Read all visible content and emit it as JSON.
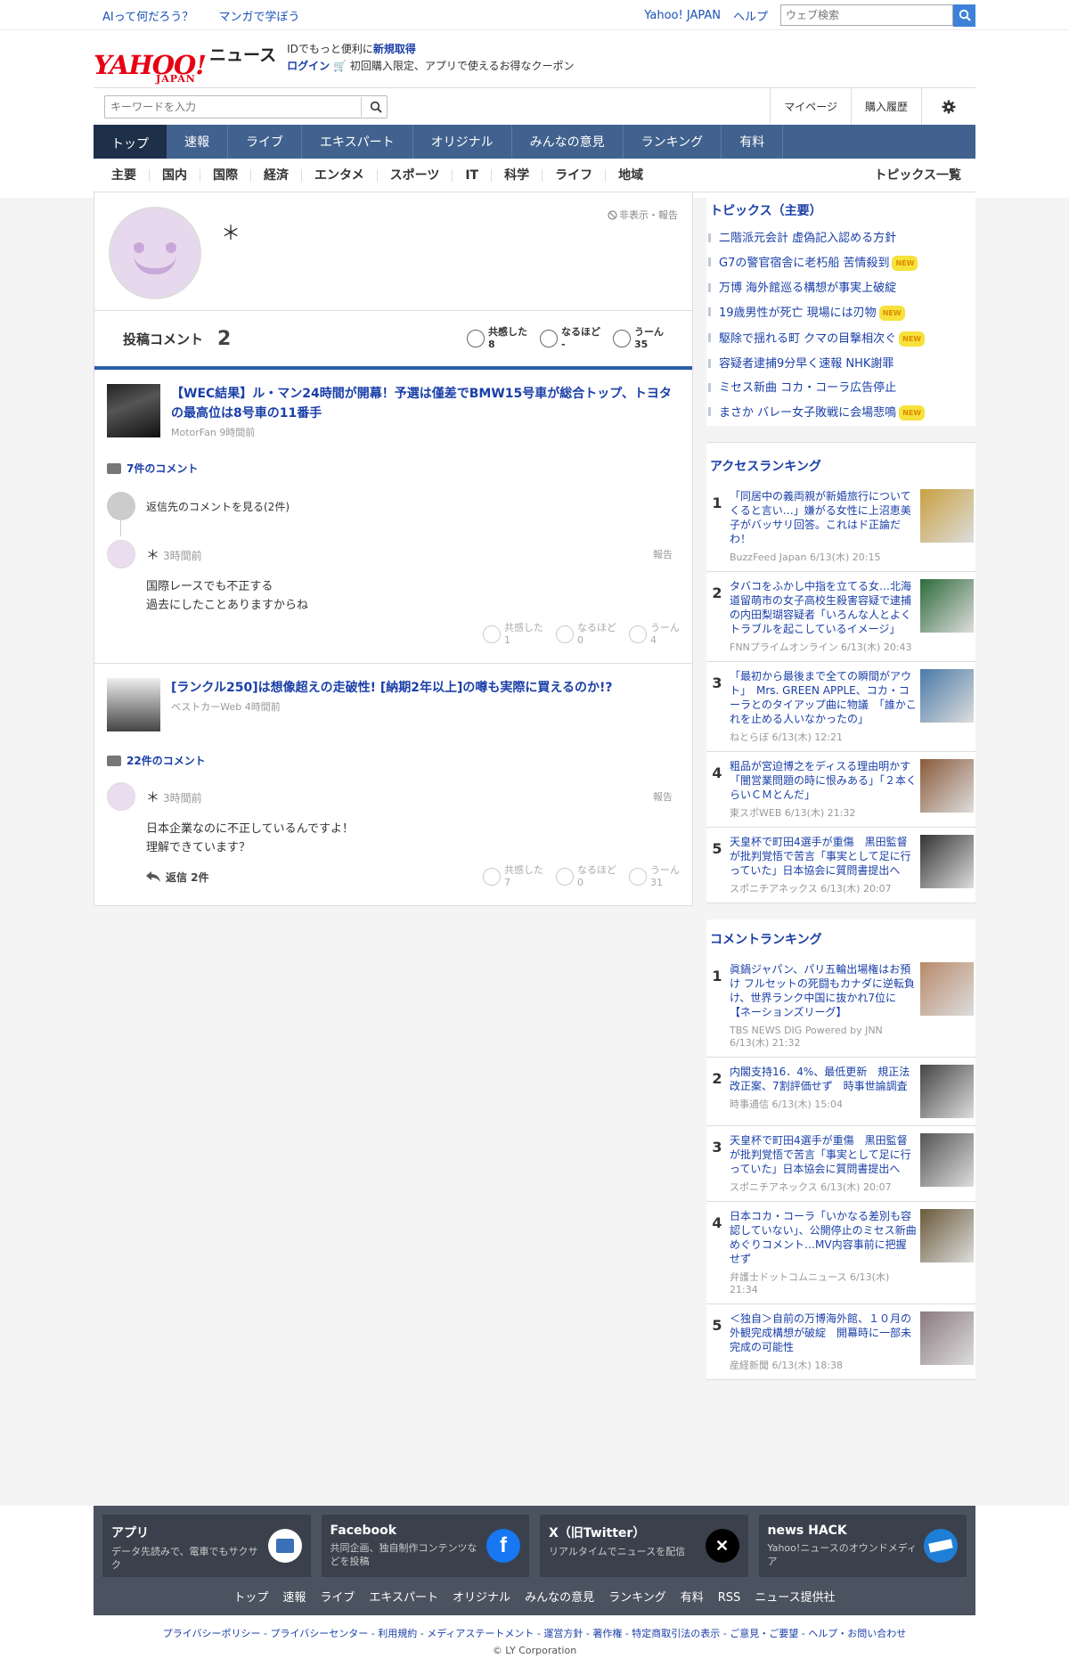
{
  "util": {
    "left_links": [
      "AIって何だろう？",
      "マンガで学ぼう"
    ],
    "right_links": [
      "Yahoo! JAPAN",
      "ヘルプ"
    ],
    "web_search_placeholder": "ウェブ検索"
  },
  "logo": {
    "brand": "YAHOO!",
    "sub": "JAPAN",
    "service": "ニュース"
  },
  "promo": {
    "line1_prefix": "IDでもっと便利に",
    "line1_link": "新規取得",
    "login": "ログイン",
    "line2": "初回購入限定、アプリで使えるお得なクーポン"
  },
  "search": {
    "placeholder": "キーワードを入力"
  },
  "mylinks": {
    "mypage": "マイページ",
    "history": "購入履歴"
  },
  "mainnav": [
    "トップ",
    "速報",
    "ライブ",
    "エキスパート",
    "オリジナル",
    "みんなの意見",
    "ランキング",
    "有料"
  ],
  "subnav": {
    "items": [
      "主要",
      "国内",
      "国際",
      "経済",
      "エンタメ",
      "スポーツ",
      "IT",
      "科学",
      "ライフ",
      "地域"
    ],
    "all": "トピックス一覧"
  },
  "profile": {
    "name": "＊",
    "hide_report": "非表示・報告"
  },
  "stats": {
    "label": "投稿コメント",
    "count": "2",
    "reactions": [
      {
        "label": "共感した",
        "value": "8"
      },
      {
        "label": "なるほど",
        "value": "-"
      },
      {
        "label": "うーん",
        "value": "35"
      }
    ]
  },
  "comments": [
    {
      "title": "【WEC結果】ル・マン24時間が開幕！予選は僅差でBMW15号車が総合トップ、トヨタの最高位は8号車の11番手",
      "source": "MotorFan 9時間前",
      "comment_count": "7件のコメント",
      "prev_link": "返信先のコメントを見る(2件)",
      "user": "＊",
      "time": "3時間前",
      "report": "報告",
      "body_1": "国際レースでも不正する",
      "body_2": "過去にしたことありますからね",
      "reactions": [
        {
          "label": "共感した",
          "value": "1"
        },
        {
          "label": "なるほど",
          "value": "0"
        },
        {
          "label": "うーん",
          "value": "4"
        }
      ]
    },
    {
      "title": "[ランクル250]は想像超えの走破性! [納期2年以上]の噂も実際に買えるのか!?",
      "source": "ベストカーWeb 4時間前",
      "comment_count": "22件のコメント",
      "user": "＊",
      "time": "3時間前",
      "report": "報告",
      "body_1": "日本企業なのに不正しているんですよ！",
      "body_2": "理解できています？",
      "replies": "返信 2件",
      "reactions": [
        {
          "label": "共感した",
          "value": "7"
        },
        {
          "label": "なるほど",
          "value": "0"
        },
        {
          "label": "うーん",
          "value": "31"
        }
      ]
    }
  ],
  "topics": {
    "title": "トピックス（主要）",
    "new_badge": "NEW",
    "items": [
      {
        "text": "二階派元会計 虚偽記入認める方針",
        "new": false
      },
      {
        "text": "G7の警官宿舎に老朽船 苦情殺到",
        "new": true
      },
      {
        "text": "万博 海外館巡る構想が事実上破綻",
        "new": false
      },
      {
        "text": "19歳男性が死亡 現場には刃物",
        "new": true
      },
      {
        "text": "駆除で揺れる町 クマの目撃相次ぐ",
        "new": true
      },
      {
        "text": "容疑者逮捕9分早く速報 NHK謝罪",
        "new": false
      },
      {
        "text": "ミセス新曲 コカ・コーラ広告停止",
        "new": false
      },
      {
        "text": "まさか バレー女子敗戦に会場悲鳴",
        "new": true
      }
    ]
  },
  "access_ranking": {
    "title": "アクセスランキング",
    "items": [
      {
        "rank": "1",
        "title": "「同居中の義両親が新婚旅行についてくると言い…」嫌がる女性に上沼恵美子がバッサリ回答。これはド正論だわ！",
        "source": "BuzzFeed Japan 6/13(木) 20:15"
      },
      {
        "rank": "2",
        "title": "タバコをふかし中指を立てる女…北海道留萌市の女子高校生殺害容疑で逮捕の内田梨瑚容疑者「いろんな人とよくトラブルを起こしているイメージ」",
        "source": "FNNプライムオンライン 6/13(木) 20:43"
      },
      {
        "rank": "3",
        "title": "「最初から最後まで全ての瞬間がアウト」　Mrs. GREEN APPLE、コカ・コーラとのタイアップ曲に物議　「誰かこれを止める人いなかったの」",
        "source": "ねとらぼ 6/13(木) 12:21"
      },
      {
        "rank": "4",
        "title": "粗品が宮迫博之をディスる理由明かす「闇営業問題の時に恨みある」「２本くらいＣＭとんだ」",
        "source": "東スポWEB 6/13(木) 21:32"
      },
      {
        "rank": "5",
        "title": "天皇杯で町田4選手が重傷　黒田監督が批判覚悟で苦言「事実として足に行っていた」日本協会に質問書提出へ",
        "source": "スポニチアネックス 6/13(木) 20:07"
      }
    ]
  },
  "comment_ranking": {
    "title": "コメントランキング",
    "items": [
      {
        "rank": "1",
        "title": "眞鍋ジャパン、パリ五輪出場権はお預け フルセットの死闘もカナダに逆転負け、世界ランク中国に抜かれ7位に【ネーションズリーグ】",
        "source": "TBS NEWS DIG Powered by JNN 6/13(木) 21:32"
      },
      {
        "rank": "2",
        "title": "内閣支持16．4%、最低更新　規正法改正案、7割評価せず　時事世論調査",
        "source": "時事通信 6/13(木) 15:04"
      },
      {
        "rank": "3",
        "title": "天皇杯で町田4選手が重傷　黒田監督が批判覚悟で苦言「事実として足に行っていた」日本協会に質問書提出へ",
        "source": "スポニチアネックス 6/13(木) 20:07"
      },
      {
        "rank": "4",
        "title": "日本コカ・コーラ「いかなる差別も容認していない」、公開停止のミセス新曲めぐりコメント…MV内容事前に把握せず",
        "source": "弁護士ドットコムニュース 6/13(木) 21:34"
      },
      {
        "rank": "5",
        "title": "＜独自＞自前の万博海外館、１０月の外観完成構想が破綻　開幕時に一部未完成の可能性",
        "source": "産経新聞 6/13(木) 18:38"
      }
    ]
  },
  "footer": {
    "cards": [
      {
        "title": "アプリ",
        "desc": "データ先読みで、電車でもサクサク",
        "icon": "yahoo-app-icon"
      },
      {
        "title": "Facebook",
        "desc": "共同企画、独自制作コンテンツなどを投稿",
        "icon": "facebook-icon"
      },
      {
        "title": "X（旧Twitter）",
        "desc": "リアルタイムでニュースを配信",
        "icon": "x-icon"
      },
      {
        "title": "news HACK",
        "desc": "Yahoo!ニュースのオウンドメディア",
        "icon": "news-hack-icon"
      }
    ],
    "links": [
      "トップ",
      "速報",
      "ライブ",
      "エキスパート",
      "オリジナル",
      "みんなの意見",
      "ランキング",
      "有料",
      "RSS",
      "ニュース提供社"
    ],
    "legal": "プライバシーポリシー - プライバシーセンター - 利用規約 - メディアステートメント - 運営方針 - 著作権 - 特定商取引法の表示 - ご意見・ご要望 - ヘルプ・お問い合わせ",
    "copyright": "© LY Corporation"
  },
  "colors": {
    "brand_red": "#e60013",
    "link_blue": "#1a3fa8",
    "nav_bg": "#41628e",
    "nav_active": "#1e2f4a",
    "footer_bg": "#4b5360"
  }
}
